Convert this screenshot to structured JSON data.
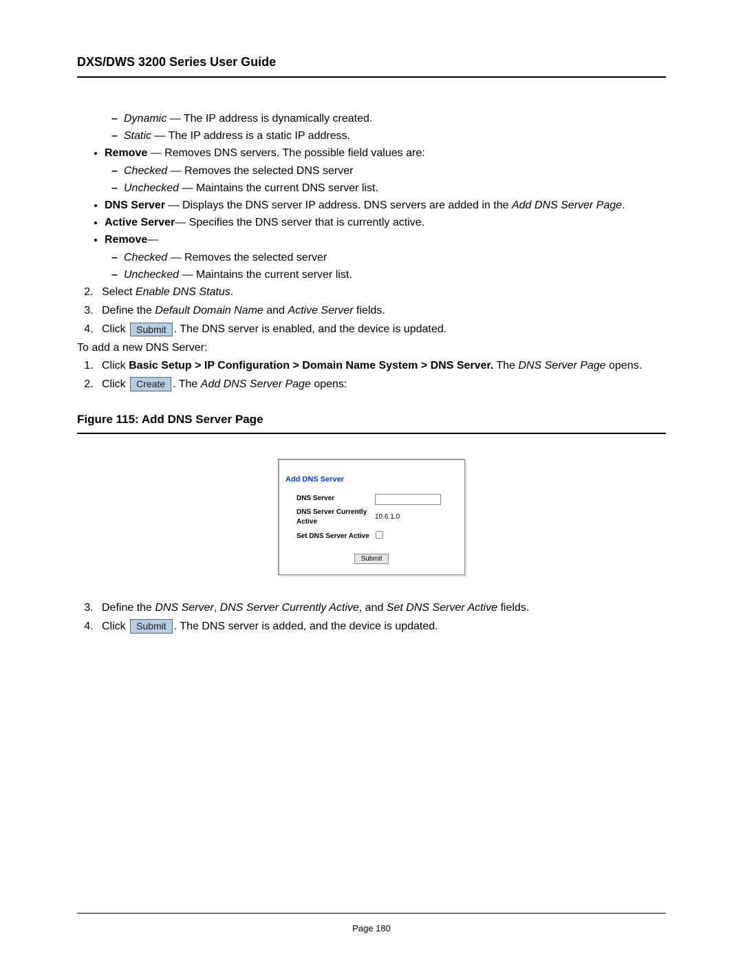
{
  "header": {
    "title": "DXS/DWS 3200 Series User Guide"
  },
  "dash_top": {
    "dynamic_label": "Dynamic",
    "dynamic_text": " — The IP address is dynamically created.",
    "static_label": "Static",
    "static_text": " — The IP address is a static IP address."
  },
  "bullets": {
    "remove": {
      "label": "Remove",
      "text": " — Removes DNS servers. The possible field values are:",
      "checked_label": "Checked",
      "checked_text": " — Removes the selected DNS server",
      "unchecked_label": "Unchecked",
      "unchecked_text": " — Maintains the current DNS server list."
    },
    "dns_server": {
      "label": "DNS Server",
      "text_a": " — Displays the DNS server IP address. DNS servers are added in the ",
      "ref": "Add DNS Server Page",
      "text_b": "."
    },
    "active_server": {
      "label": "Active Server",
      "text": "— Specifies the DNS server that is currently active."
    },
    "remove2": {
      "label": "Remove",
      "dash": "—",
      "checked_label": "Checked",
      "checked_text": " — Removes the selected server",
      "unchecked_label": "Unchecked",
      "unchecked_text": " — Maintains the current server list."
    }
  },
  "steps_a": {
    "s2_a": "Select ",
    "s2_i": "Enable DNS Status",
    "s2_b": ".",
    "s3_a": "Define the ",
    "s3_i1": "Default Domain Name",
    "s3_mid": " and ",
    "s3_i2": "Active Server",
    "s3_b": " fields.",
    "s4_a": "Click ",
    "s4_btn": "Submit",
    "s4_b": ". The DNS server is enabled, and the device is updated."
  },
  "to_add": "To add a new DNS Server:",
  "steps_b": {
    "s1_a": "Click ",
    "s1_bold": "Basic Setup > IP Configuration > Domain Name System > DNS Server.",
    "s1_mid": " The ",
    "s1_i": "DNS Server Page",
    "s1_b": " opens.",
    "s2_a": "Click ",
    "s2_btn": "Create",
    "s2_mid": ". The ",
    "s2_i": "Add DNS Server Page",
    "s2_b": " opens:"
  },
  "figure": {
    "caption": "Figure 115: Add DNS Server Page"
  },
  "dialog": {
    "title": "Add DNS Server",
    "row1_label": "DNS Server",
    "row1_value": "",
    "row2_label": "DNS Server Currently Active",
    "row2_value": "10.6.1.0",
    "row3_label": "Set DNS Server Active",
    "submit": "Submit"
  },
  "steps_c": {
    "s3_a": "Define the ",
    "s3_i1": "DNS Server",
    "s3_c1": ", ",
    "s3_i2": "DNS Server Currently Active",
    "s3_c2": ", and ",
    "s3_i3": "Set DNS Server Active",
    "s3_b": " fields.",
    "s4_a": "Click ",
    "s4_btn": "Submit",
    "s4_b": ". The DNS server is added, and the device is updated."
  },
  "footer": {
    "page": "Page 180"
  }
}
